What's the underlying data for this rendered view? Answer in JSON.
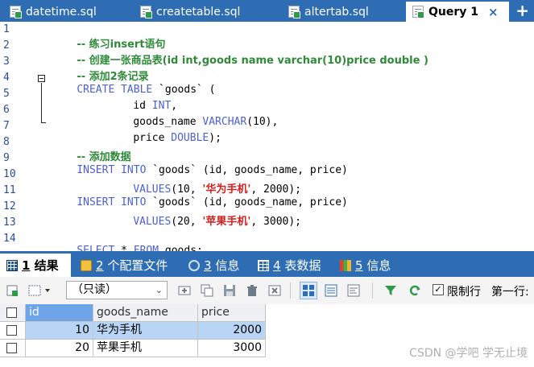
{
  "file_tabs": [
    {
      "label": "datetime.sql",
      "icon": "sql-file-icon"
    },
    {
      "label": "createtable.sql",
      "icon": "sql-file-icon"
    },
    {
      "label": "altertab.sql",
      "icon": "sql-file-icon"
    },
    {
      "label": "Query 1",
      "icon": "sql-file-icon",
      "active": true
    }
  ],
  "close_glyph": "×",
  "add_glyph": "+",
  "editor": {
    "line_numbers": [
      "1",
      "2",
      "3",
      "4",
      "5",
      "6",
      "7",
      "8",
      "9",
      "10",
      "11",
      "12",
      "13",
      "14"
    ],
    "lines": {
      "l1": {
        "c": "-- 练习insert语句"
      },
      "l2": {
        "c": "-- 创建一张商品表(id int,goods name varchar(10)price double )"
      },
      "l3": {
        "c": "-- 添加2条记录"
      },
      "l4": {
        "kw": "CREATE TABLE",
        "rest": " `goods` ("
      },
      "l5": {
        "a": "id ",
        "kw": "INT",
        "b": ","
      },
      "l6": {
        "a": "goods_name ",
        "kw": "VARCHAR",
        "b": "(10),"
      },
      "l7": {
        "a": "price ",
        "kw": "DOUBLE",
        "b": ");"
      },
      "l8": {
        "c": "-- 添加数据"
      },
      "l9": {
        "kw": "INSERT INTO",
        "rest": " `goods` (id, goods_name, price)"
      },
      "l10": {
        "kw": "VALUES",
        "a": "(10, ",
        "s": "'华为手机'",
        "b": ", 2000);"
      },
      "l11": {
        "kw": "INSERT INTO",
        "rest": " `goods` (id, goods_name, price)"
      },
      "l12": {
        "kw": "VALUES",
        "a": "(20, ",
        "s": "'苹果手机'",
        "b": ", 3000);"
      },
      "l14": {
        "kw1": "SELECT",
        "a": " * ",
        "kw2": "FROM",
        "b": " goods;"
      }
    }
  },
  "result_tabs": [
    {
      "num": "1",
      "label": " 结果",
      "icon": "grid-icon",
      "active": true
    },
    {
      "num": "2",
      "label": " 个配置文件",
      "icon": "profile-icon"
    },
    {
      "num": "3",
      "label": " 信息",
      "icon": "info-icon"
    },
    {
      "num": "4",
      "label": " 表数据",
      "icon": "table-data-icon"
    },
    {
      "num": "5",
      "label": " 信息",
      "icon": "info-bars-icon"
    }
  ],
  "toolbar": {
    "readonly_select": "（只读）",
    "limit_label": "限制行",
    "limit_checked": "✓",
    "first_row_label": "第一行:"
  },
  "grid": {
    "columns": [
      "id",
      "goods_name",
      "price"
    ],
    "rows": [
      {
        "id": "10",
        "goods_name": "华为手机",
        "price": "2000"
      },
      {
        "id": "20",
        "goods_name": "苹果手机",
        "price": "3000"
      }
    ]
  },
  "watermark": "CSDN @学吧 学无止境"
}
